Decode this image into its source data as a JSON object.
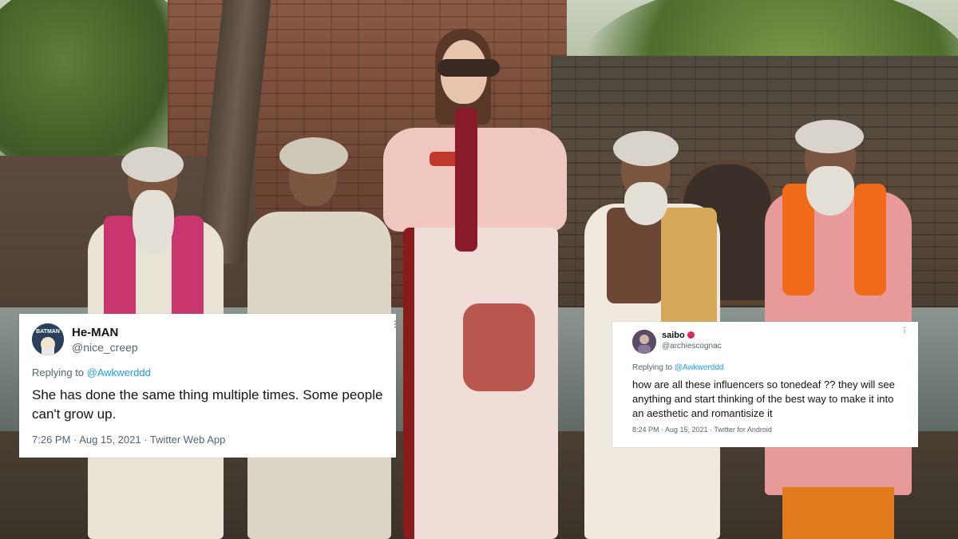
{
  "tweets": [
    {
      "name": "He-MAN",
      "handle": "@nice_creep",
      "more_icon": "more-dots-icon",
      "replying_prefix": "Replying to ",
      "replying_to": "@Awkwerddd",
      "text": "She has done the same thing multiple times. Some people can't grow up.",
      "meta": "7:26 PM · Aug 15, 2021 · Twitter Web App",
      "avatar_icon": "batman-avatar-icon",
      "avatar_text": "BATMAN"
    },
    {
      "name": "saibo",
      "name_badge_icon": "tomato-emoji-icon",
      "handle": "@archiescognac",
      "more_icon": "more-dots-icon",
      "replying_prefix": "Replying to ",
      "replying_to": "@Awkwerddd",
      "text": "how are all these influencers so tonedeaf ?? they will see anything and start thinking of the best way to make it into an aesthetic and romantisize it",
      "meta": "8:24 PM · Aug 15, 2021 · Twitter for Android",
      "avatar_icon": "profile-avatar-icon"
    }
  ],
  "colors": {
    "link": "#1d9bf0",
    "secondary_text": "#536471",
    "primary_text": "#0f1419",
    "card_bg": "#ffffff"
  }
}
